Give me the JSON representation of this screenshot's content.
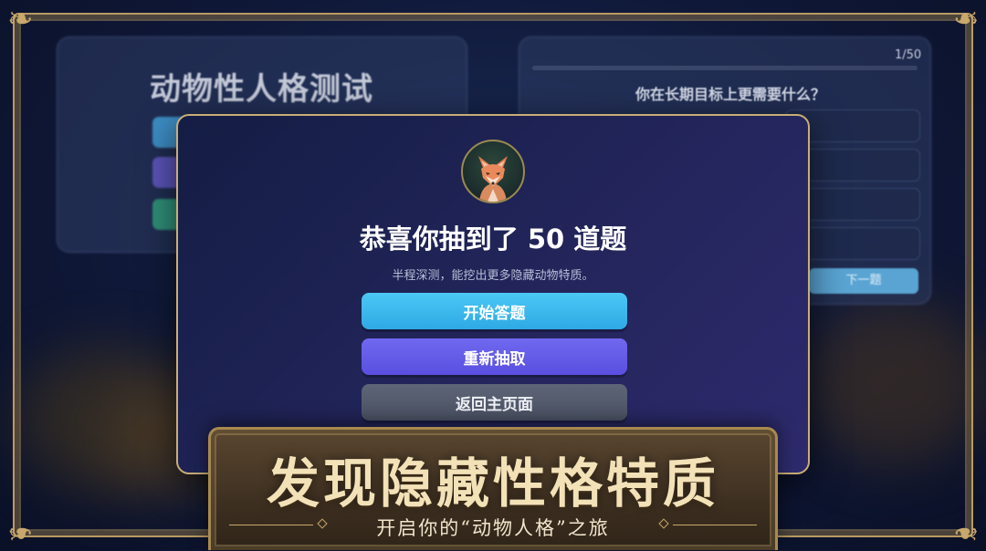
{
  "background": {
    "left_panel": {
      "title": "动物性人格测试"
    },
    "right_panel": {
      "progress": "1/50",
      "question": "你在长期目标上更需要什么？",
      "next_button": "下一题"
    }
  },
  "modal": {
    "avatar_icon": "fox-icon",
    "title": "恭喜你抽到了 50 道题",
    "subtitle": "半程深测，能挖出更多隐藏动物特质。",
    "buttons": {
      "start": "开始答题",
      "redraw": "重新抽取",
      "home": "返回主页面"
    }
  },
  "banner": {
    "title": "发现隐藏性格特质",
    "subtitle": "开启你的“动物人格”之旅"
  },
  "colors": {
    "accent_blue": "#3ab8ee",
    "accent_purple": "#6258e8",
    "neutral_button": "#555c6e",
    "gold": "#c9a86c"
  }
}
